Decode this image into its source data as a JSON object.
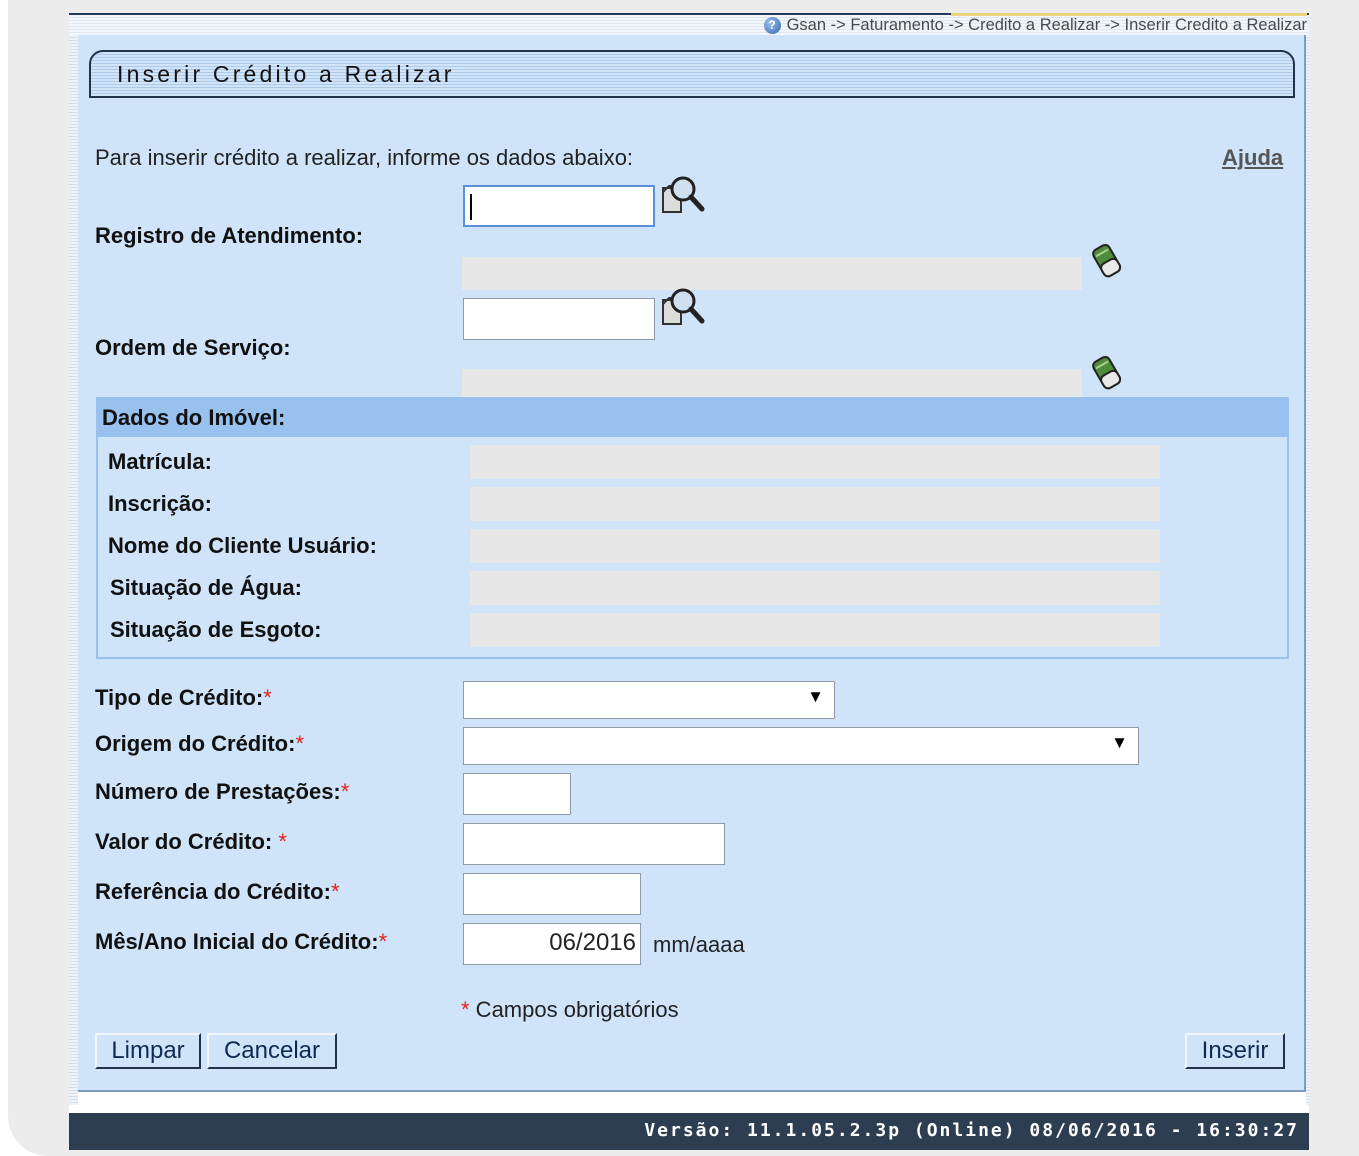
{
  "breadcrumb": "Gsan -> Faturamento -> Credito a Realizar -> Inserir Credito a Realizar",
  "title": "Inserir Crédito a Realizar",
  "intro": "Para inserir crédito a realizar, informe os dados abaixo:",
  "help_link": "Ajuda",
  "registro": {
    "label": "Registro de Atendimento:",
    "value": "",
    "description": ""
  },
  "ordem": {
    "label": "Ordem de Serviço:",
    "value": "",
    "description": ""
  },
  "imovel": {
    "title": "Dados do Imóvel:",
    "fields": [
      {
        "label": "Matrícula:",
        "value": ""
      },
      {
        "label": "Inscrição:",
        "value": ""
      },
      {
        "label": "Nome do Cliente Usuário:",
        "value": ""
      },
      {
        "label": "Situação de Água:",
        "value": ""
      },
      {
        "label": "Situação de Esgoto:",
        "value": ""
      }
    ]
  },
  "form": {
    "tipo_credito": {
      "label": "Tipo de Crédito:",
      "selected": ""
    },
    "origem_credito": {
      "label": "Origem do Crédito:",
      "selected": ""
    },
    "numero_prestacoes": {
      "label": "Número de Prestações:",
      "value": ""
    },
    "valor_credito": {
      "label": "Valor do Crédito: ",
      "value": ""
    },
    "referencia_credito": {
      "label": "Referência do Crédito:",
      "value": ""
    },
    "mes_ano_inicial": {
      "label": "Mês/Ano Inicial do Crédito:",
      "value": "06/2016",
      "hint": "mm/aaaa"
    }
  },
  "required_mark": "*",
  "required_note": " Campos obrigatórios",
  "buttons": {
    "limpar": "Limpar",
    "cancelar": "Cancelar",
    "inserir": "Inserir"
  },
  "version": "Versão: 11.1.05.2.3p (Online) 08/06/2016 - 16:30:27",
  "icons": [
    "help-icon",
    "magnifier-icon",
    "eraser-icon"
  ],
  "colors": {
    "panel": "#cfe3f9",
    "section_header": "#98c1ee",
    "version_bar": "#2e3e52",
    "required": "#e2231a"
  }
}
